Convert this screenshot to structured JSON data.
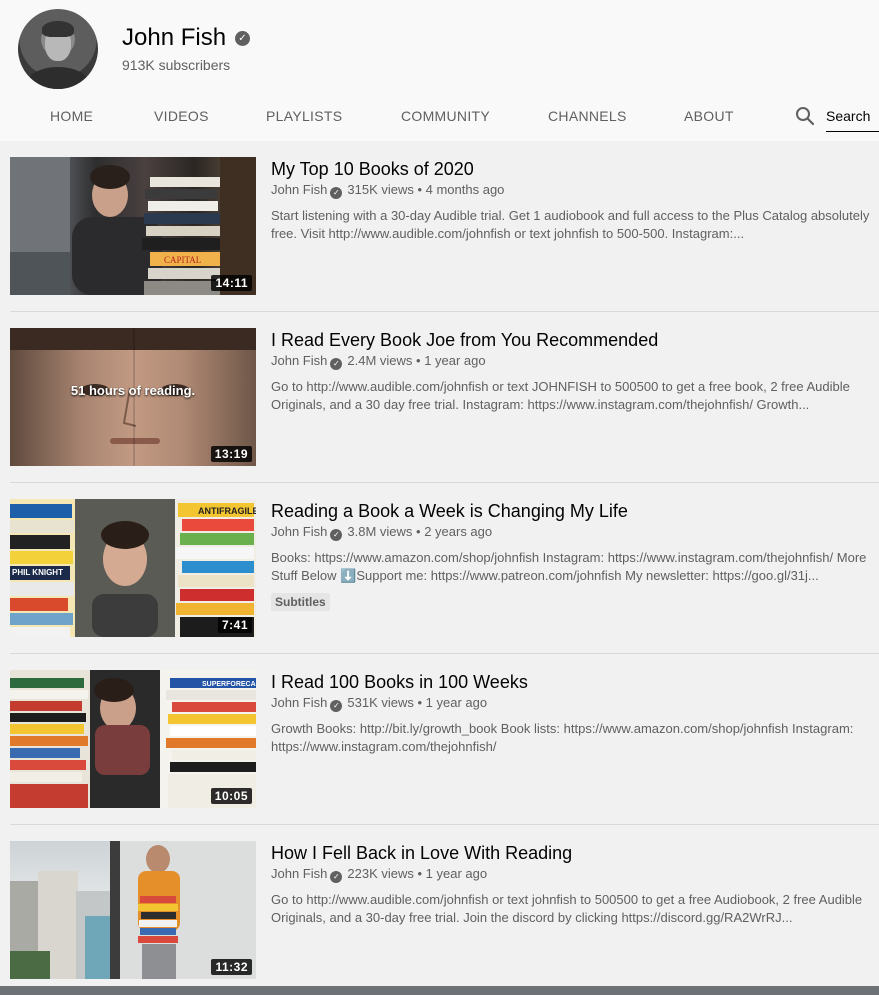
{
  "channel": {
    "name": "John Fish",
    "verified_icon": "verified-check-icon",
    "subscribers": "913K subscribers"
  },
  "tabs": [
    {
      "label": "HOME"
    },
    {
      "label": "VIDEOS"
    },
    {
      "label": "PLAYLISTS"
    },
    {
      "label": "COMMUNITY"
    },
    {
      "label": "CHANNELS"
    },
    {
      "label": "ABOUT"
    }
  ],
  "search": {
    "label": "Search",
    "icon": "search-icon"
  },
  "videos": [
    {
      "title": "My Top 10 Books of 2020",
      "channel": "John Fish",
      "views": "315K views",
      "age": "4 months ago",
      "description": "Start listening with a 30-day Audible trial. Get 1 audiobook and full access to the Plus Catalog absolutely free. Visit http://www.audible.com/johnfish or text johnfish to 500-500. Instagram:...",
      "duration": "14:11"
    },
    {
      "title": "I Read Every Book Joe from You Recommended",
      "channel": "John Fish",
      "views": "2.4M views",
      "age": "1 year ago",
      "description": "Go to http://www.audible.com/johnfish or text JOHNFISH to 500500 to get a free book, 2 free Audible Originals, and a 30 day free trial. Instagram: https://www.instagram.com/thejohnfish/ Growth...",
      "duration": "13:19",
      "thumb_text": "51 hours of reading."
    },
    {
      "title": "Reading a Book a Week is Changing My Life",
      "channel": "John Fish",
      "views": "3.8M views",
      "age": "2 years ago",
      "description": "Books: https://www.amazon.com/shop/johnfish Instagram: https://www.instagram.com/thejohnfish/ More Stuff Below ⬇️Support me: https://www.patreon.com/johnfish My newsletter: https://goo.gl/31j...",
      "duration": "7:41",
      "badge": "Subtitles"
    },
    {
      "title": "I Read 100 Books in 100 Weeks",
      "channel": "John Fish",
      "views": "531K views",
      "age": "1 year ago",
      "description": "Growth Books: http://bit.ly/growth_book Book lists: https://www.amazon.com/shop/johnfish Instagram: https://www.instagram.com/thejohnfish/",
      "duration": "10:05"
    },
    {
      "title": "How I Fell Back in Love With Reading",
      "channel": "John Fish",
      "views": "223K views",
      "age": "1 year ago",
      "description": "Go to http://www.audible.com/johnfish or text johnfish to 500500 to get a free Audiobook, 2 free Audible Originals, and a 30-day free trial. Join the discord by clicking https://discord.gg/RA2WrRJ...",
      "duration": "11:32"
    }
  ]
}
